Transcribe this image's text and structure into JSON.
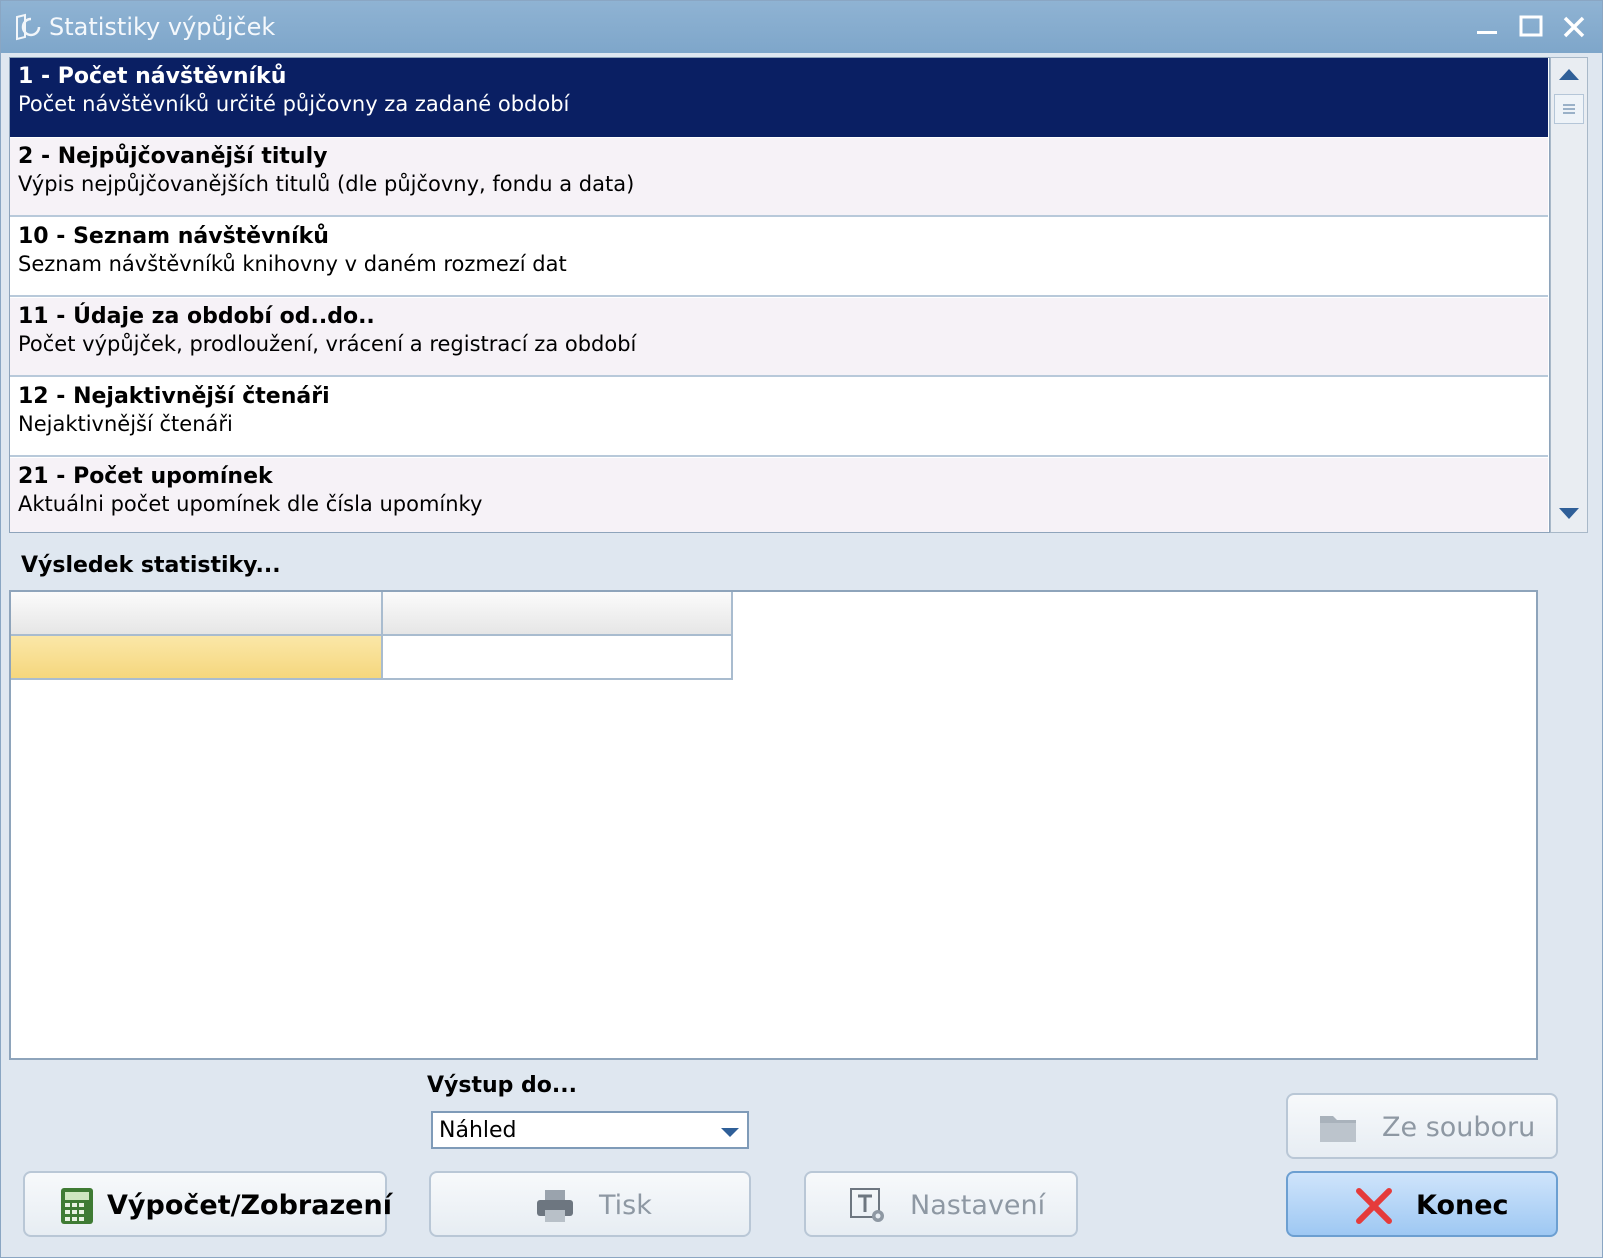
{
  "window": {
    "title": "Statistiky výpůjček"
  },
  "statistics_list": [
    {
      "title": "1 - Počet návštěvníků",
      "description": "Počet návštěvníků určité půjčovny za zadané období"
    },
    {
      "title": "2 - Nejpůjčovanější tituly",
      "description": "Výpis nejpůjčovanějších titulů (dle půjčovny, fondu a data)"
    },
    {
      "title": "10 - Seznam návštěvníků",
      "description": "Seznam návštěvníků knihovny v daném rozmezí dat"
    },
    {
      "title": "11 - Údaje za období od..do..",
      "description": "Počet výpůjček, prodloužení, vrácení a registrací za období"
    },
    {
      "title": "12 - Nejaktivnější čtenáři",
      "description": "Nejaktivnější čtenáři"
    },
    {
      "title": "21 - Počet upomínek",
      "description": "Aktuálni počet upomínek dle čísla upomínky"
    }
  ],
  "selected_index": 0,
  "result": {
    "label": "Výsledek statistiky..."
  },
  "output": {
    "label": "Výstup do...",
    "value": "Náhled"
  },
  "buttons": {
    "calculate": "Výpočet/Zobrazení",
    "print": "Tisk",
    "settings": "Nastavení",
    "from_file": "Ze souboru",
    "close": "Konec"
  },
  "colors": {
    "selection": "#0a1f63",
    "titlebar": "#86acd0",
    "close_icon": "#e53b3b"
  }
}
